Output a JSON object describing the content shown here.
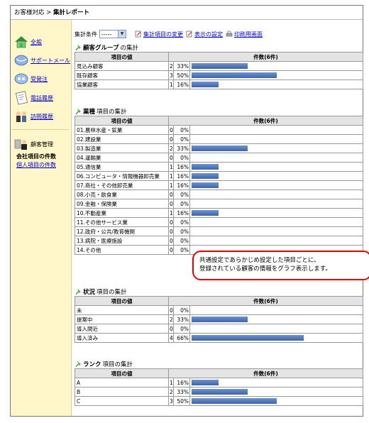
{
  "breadcrumb": {
    "parent": "お客様対応",
    "separator": " > ",
    "current": "集計レポート"
  },
  "sidebar": {
    "items": [
      {
        "label": "全般",
        "icon": "house-icon"
      },
      {
        "label": "サポートメール",
        "icon": "mail-icon"
      },
      {
        "label": "受発注",
        "icon": "order-icon"
      },
      {
        "label": "電話履歴",
        "icon": "phone-note-icon"
      },
      {
        "label": "訪問履歴",
        "icon": "visit-icon"
      }
    ],
    "manager": {
      "label": "顧客管理",
      "icon": "customer-icon"
    },
    "sub_active": "会社項目の件数",
    "sub_link": "個人項目の件数"
  },
  "toolbar": {
    "filter_label": "集計条件",
    "filter_value": "-----",
    "change_items": "集計項目の変更",
    "display_settings": "表示の設定",
    "print_screen": "印刷用画面"
  },
  "sections": [
    {
      "title_bold": "顧客グループ",
      "title_suffix": "の集計",
      "col_item": "項目の値",
      "col_count": "件数(6件)",
      "rows": [
        {
          "label": "見込み顧客",
          "count": "2",
          "pct": "33%",
          "ratio": 0.33
        },
        {
          "label": "既存顧客",
          "count": "3",
          "pct": "50%",
          "ratio": 0.5
        },
        {
          "label": "協業顧客",
          "count": "1",
          "pct": "16%",
          "ratio": 0.16
        }
      ]
    },
    {
      "title_bold": "業種",
      "title_suffix": "項目の集計",
      "col_item": "項目の値",
      "col_count": "件数(6件)",
      "rows": [
        {
          "label": "01.農林水産・鉱業",
          "count": "0",
          "pct": "0%",
          "ratio": 0
        },
        {
          "label": "02.建設業",
          "count": "0",
          "pct": "0%",
          "ratio": 0
        },
        {
          "label": "03.製造業",
          "count": "2",
          "pct": "33%",
          "ratio": 0.33
        },
        {
          "label": "04.運輸業",
          "count": "0",
          "pct": "0%",
          "ratio": 0
        },
        {
          "label": "05.通信業",
          "count": "1",
          "pct": "16%",
          "ratio": 0.16
        },
        {
          "label": "06.コンピュータ・情報機器卸売業",
          "count": "1",
          "pct": "16%",
          "ratio": 0.16
        },
        {
          "label": "07.商社・その他卸売業",
          "count": "1",
          "pct": "16%",
          "ratio": 0.16
        },
        {
          "label": "08.小売・飲食業",
          "count": "0",
          "pct": "0%",
          "ratio": 0
        },
        {
          "label": "09.金融・保険業",
          "count": "0",
          "pct": "0%",
          "ratio": 0
        },
        {
          "label": "10.不動産業",
          "count": "1",
          "pct": "16%",
          "ratio": 0.16
        },
        {
          "label": "11.その他サービス業",
          "count": "0",
          "pct": "0%",
          "ratio": 0
        },
        {
          "label": "12.政府・公共/教育機関",
          "count": "0",
          "pct": "0%",
          "ratio": 0
        },
        {
          "label": "13.病院・医療施設",
          "count": "0",
          "pct": "0%",
          "ratio": 0
        },
        {
          "label": "14.その他",
          "count": "0",
          "pct": "0%",
          "ratio": 0
        }
      ]
    },
    {
      "title_bold": "状況",
      "title_suffix": "項目の集計",
      "col_item": "項目の値",
      "col_count": "件数(6件)",
      "rows": [
        {
          "label": "未",
          "count": "0",
          "pct": "0%",
          "ratio": 0
        },
        {
          "label": "提案中",
          "count": "2",
          "pct": "33%",
          "ratio": 0.33
        },
        {
          "label": "導入間近",
          "count": "0",
          "pct": "0%",
          "ratio": 0
        },
        {
          "label": "導入済み",
          "count": "4",
          "pct": "66%",
          "ratio": 0.66
        }
      ]
    },
    {
      "title_bold": "ランク",
      "title_suffix": "項目の集計",
      "col_item": "項目の値",
      "col_count": "件数(6件)",
      "rows": [
        {
          "label": "A",
          "count": "1",
          "pct": "16%",
          "ratio": 0.16
        },
        {
          "label": "B",
          "count": "2",
          "pct": "33%",
          "ratio": 0.33
        },
        {
          "label": "C",
          "count": "3",
          "pct": "50%",
          "ratio": 0.5
        }
      ]
    }
  ],
  "callout": {
    "line1": "共通設定であらかじめ設定した項目ごとに、",
    "line2": "登録されている顧客の情報をグラフ表示します。"
  },
  "colors": {
    "bar": "#4a71b5",
    "callout_border": "#e00000",
    "sidebar_bg": "#fff6c9"
  }
}
